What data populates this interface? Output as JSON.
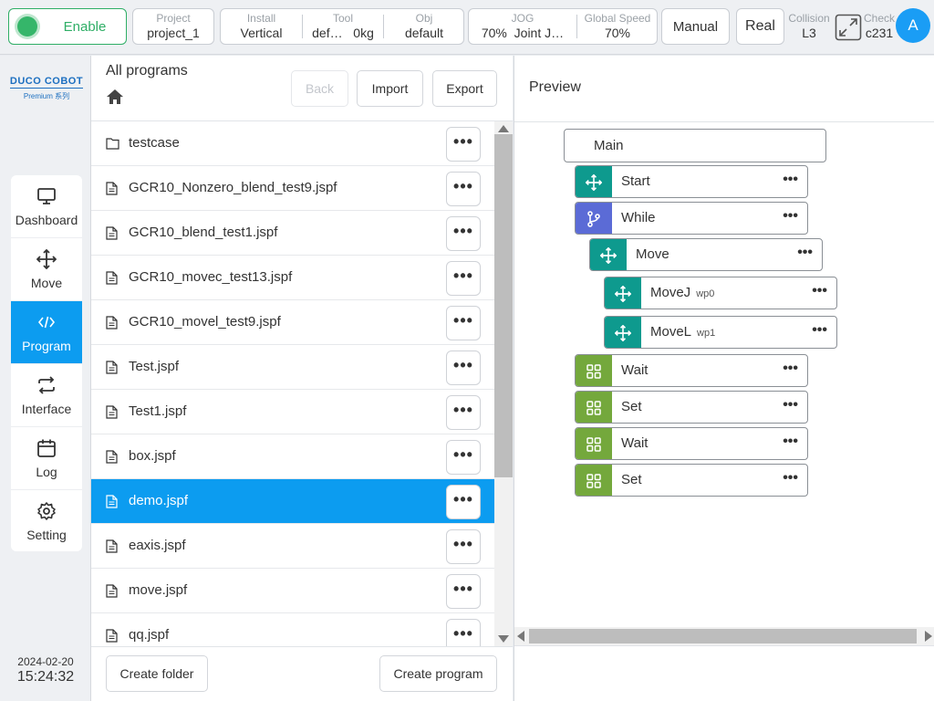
{
  "topbar": {
    "enable_label": "Enable",
    "project": {
      "title": "Project",
      "value": "project_1"
    },
    "install": {
      "title": "Install",
      "value": "Vertical"
    },
    "tool": {
      "title": "Tool",
      "name": "def…",
      "weight": "0kg"
    },
    "obj": {
      "title": "Obj",
      "value": "default"
    },
    "jog": {
      "title": "JOG",
      "value": "70%  Joint J…"
    },
    "global_speed": {
      "title": "Global Speed",
      "value": "70%"
    },
    "mode_label": "Manual",
    "real_label": "Real",
    "collision": {
      "title": "Collision",
      "value": "L3"
    },
    "check": {
      "title": "Check",
      "value": "c231"
    },
    "avatar_letter": "A"
  },
  "logo": {
    "line1": "DUCO COBOT",
    "line2": "Premium 系列"
  },
  "nav": [
    {
      "label": "Dashboard",
      "icon": "monitor-icon"
    },
    {
      "label": "Move",
      "icon": "move-arrows-icon"
    },
    {
      "label": "Program",
      "icon": "code-icon"
    },
    {
      "label": "Interface",
      "icon": "swap-icon"
    },
    {
      "label": "Log",
      "icon": "calendar-icon"
    },
    {
      "label": "Setting",
      "icon": "gear-icon"
    }
  ],
  "clock": {
    "date": "2024-02-20",
    "time": "15:24:32"
  },
  "programs": {
    "title": "All programs",
    "back_label": "Back",
    "import_label": "Import",
    "export_label": "Export",
    "files": [
      {
        "name": "testcase",
        "type": "folder"
      },
      {
        "name": "GCR10_Nonzero_blend_test9.jspf",
        "type": "file"
      },
      {
        "name": "GCR10_blend_test1.jspf",
        "type": "file"
      },
      {
        "name": "GCR10_movec_test13.jspf",
        "type": "file"
      },
      {
        "name": "GCR10_movel_test9.jspf",
        "type": "file"
      },
      {
        "name": "Test.jspf",
        "type": "file"
      },
      {
        "name": "Test1.jspf",
        "type": "file"
      },
      {
        "name": "box.jspf",
        "type": "file"
      },
      {
        "name": "demo.jspf",
        "type": "file",
        "selected": true
      },
      {
        "name": "eaxis.jspf",
        "type": "file"
      },
      {
        "name": "move.jspf",
        "type": "file"
      },
      {
        "name": "qq.jspf",
        "type": "file"
      }
    ],
    "create_folder_label": "Create folder",
    "create_program_label": "Create program"
  },
  "preview": {
    "title": "Preview",
    "main_label": "Main",
    "blocks": [
      {
        "label": "Start",
        "sub": "",
        "icon": "move-arrows-icon",
        "color": "#0e9a8e"
      },
      {
        "label": "While",
        "sub": "",
        "icon": "branch-icon",
        "color": "#5b6bd6"
      },
      {
        "label": "Move",
        "sub": "",
        "icon": "move-arrows-icon",
        "color": "#0e9a8e"
      },
      {
        "label": "MoveJ",
        "sub": "wp0",
        "icon": "move-arrows-icon",
        "color": "#0e9a8e"
      },
      {
        "label": "MoveL",
        "sub": "wp1",
        "icon": "move-arrows-icon",
        "color": "#0e9a8e"
      },
      {
        "label": "Wait",
        "sub": "",
        "icon": "grid-icon",
        "color": "#74a83c"
      },
      {
        "label": "Set",
        "sub": "",
        "icon": "grid-icon",
        "color": "#74a83c"
      },
      {
        "label": "Wait",
        "sub": "",
        "icon": "grid-icon",
        "color": "#74a83c"
      },
      {
        "label": "Set",
        "sub": "",
        "icon": "grid-icon",
        "color": "#74a83c"
      }
    ]
  },
  "more_glyph": "•••"
}
